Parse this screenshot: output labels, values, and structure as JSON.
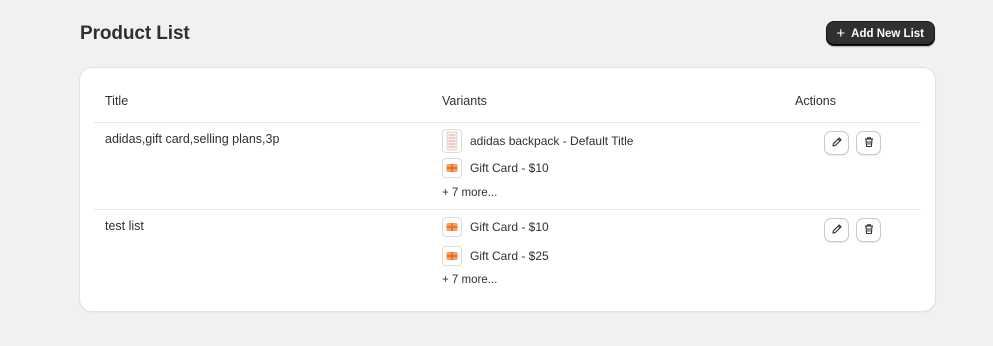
{
  "header": {
    "title": "Product List",
    "add_button_label": "Add New List",
    "add_icon": "plus-icon"
  },
  "table": {
    "columns": [
      "Title",
      "Variants",
      "Actions"
    ],
    "rows": [
      {
        "title": "adidas,gift card,selling plans,3p",
        "variants": [
          {
            "name": "adidas backpack - Default Title",
            "thumb": "backpack-thumbnail"
          },
          {
            "name": "Gift Card - $10",
            "thumb": "gift-card-thumbnail"
          }
        ],
        "more": "+ 7 more..."
      },
      {
        "title": "test list",
        "variants": [
          {
            "name": "Gift Card - $10",
            "thumb": "gift-card-thumbnail"
          },
          {
            "name": "Gift Card - $25",
            "thumb": "gift-card-thumbnail"
          }
        ],
        "more": "+ 7 more..."
      }
    ],
    "actions": {
      "edit_icon": "pencil-icon",
      "delete_icon": "trash-icon"
    }
  },
  "colors": {
    "background": "#f1f1f1",
    "primary_button": "#303030",
    "card": "#ffffff",
    "gift_card_accent": "#e8732c"
  }
}
